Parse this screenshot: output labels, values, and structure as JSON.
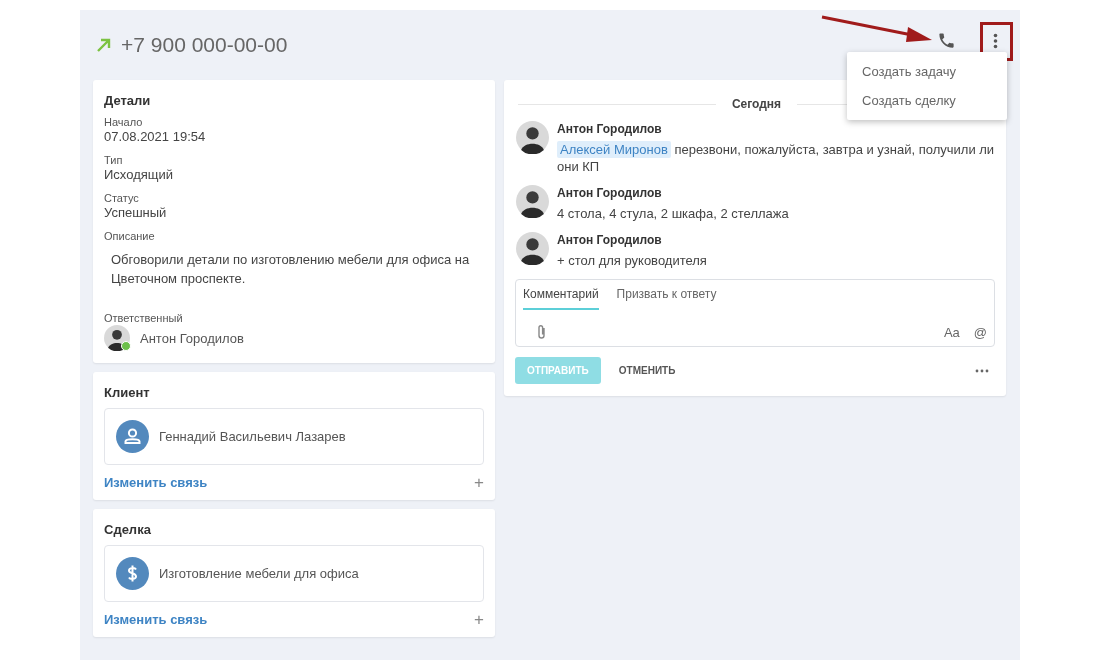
{
  "header": {
    "phone": "+7 900 000-00-00"
  },
  "menu": {
    "open": true,
    "items": [
      "Создать задачу",
      "Создать сделку"
    ]
  },
  "annotation": {
    "shown": true
  },
  "details": {
    "title": "Детали",
    "fields": [
      {
        "label": "Начало",
        "value": "07.08.2021 19:54"
      },
      {
        "label": "Тип",
        "value": "Исходящий"
      },
      {
        "label": "Статус",
        "value": "Успешный"
      }
    ],
    "description": {
      "label": "Описание",
      "text": "Обговорили детали по изготовлению мебели для офиса на Цветочном проспекте."
    },
    "responsible": {
      "label": "Ответственный",
      "name": "Антон Городилов",
      "online": true
    }
  },
  "links": [
    {
      "title": "Клиент",
      "kind": "person",
      "name": "Геннадий Васильевич Лазарев",
      "action": "Изменить связь",
      "add": "+"
    },
    {
      "title": "Сделка",
      "kind": "deal",
      "name": "Изготовление мебели для офиса",
      "action": "Изменить связь",
      "add": "+"
    }
  ],
  "feed": {
    "date": "Сегодня",
    "comments": [
      {
        "author": "Антон Городилов",
        "mention": "Алексей Миронов",
        "text": "перезвони, пожалуйста, завтра и узнай, получили ли они КП"
      },
      {
        "author": "Антон Городилов",
        "text": "4 стола, 4 стула, 2 шкафа, 2 стеллажа"
      },
      {
        "author": "Антон Городилов",
        "text": "+ стол для руководителя"
      }
    ]
  },
  "composer": {
    "tabs": [
      {
        "label": "Комментарий",
        "selected": true
      },
      {
        "label": "Призвать к ответу",
        "selected": false
      }
    ],
    "format": "Aa",
    "mention": "@",
    "send": "ОТПРАВИТЬ",
    "send_disabled": true,
    "cancel": "ОТМЕНИТЬ"
  }
}
